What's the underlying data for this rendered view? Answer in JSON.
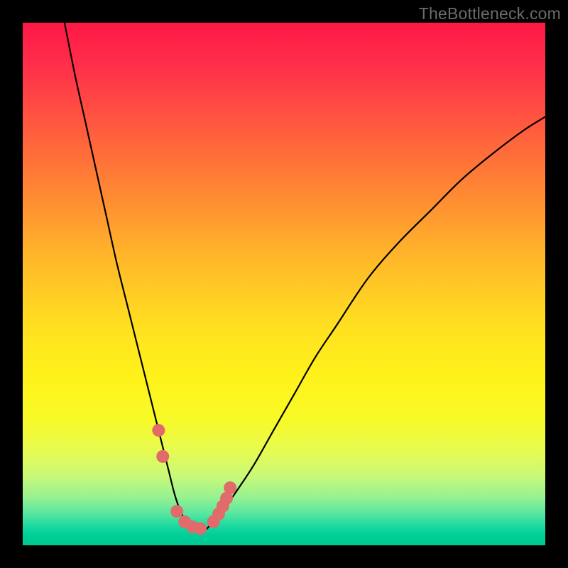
{
  "watermark": "TheBottleneck.com",
  "chart_data": {
    "type": "line",
    "title": "",
    "xlabel": "",
    "ylabel": "",
    "xlim": [
      0,
      100
    ],
    "ylim": [
      0,
      100
    ],
    "grid": false,
    "series": [
      {
        "name": "curve",
        "x": [
          8,
          10,
          12,
          14,
          16,
          18,
          20,
          22,
          24,
          25,
          26,
          27,
          28,
          29,
          30,
          31,
          32,
          33,
          34,
          35,
          36,
          38,
          40,
          44,
          48,
          52,
          56,
          60,
          66,
          72,
          78,
          84,
          90,
          96,
          100
        ],
        "y": [
          100,
          90,
          81,
          72,
          63,
          54,
          46,
          38,
          30,
          26,
          22,
          18,
          14,
          10,
          7,
          5,
          4,
          3,
          3,
          3,
          4,
          6,
          9,
          15,
          22,
          29,
          36,
          42,
          51,
          58,
          64,
          70,
          75,
          79.5,
          82
        ]
      }
    ],
    "markers": {
      "name": "highlight-points",
      "color": "#e16a6b",
      "points": [
        {
          "x": 26.0,
          "y": 22
        },
        {
          "x": 26.8,
          "y": 17
        },
        {
          "x": 29.5,
          "y": 6.5
        },
        {
          "x": 31.0,
          "y": 4.5
        },
        {
          "x": 32.5,
          "y": 3.5
        },
        {
          "x": 34.0,
          "y": 3.2
        },
        {
          "x": 36.5,
          "y": 4.5
        },
        {
          "x": 37.5,
          "y": 6.0
        },
        {
          "x": 38.3,
          "y": 7.5
        },
        {
          "x": 39.0,
          "y": 9.0
        },
        {
          "x": 39.7,
          "y": 11.0
        }
      ]
    },
    "background_gradient": {
      "top": "#ff1846",
      "mid": "#ffe020",
      "bottom": "#00c892"
    }
  }
}
